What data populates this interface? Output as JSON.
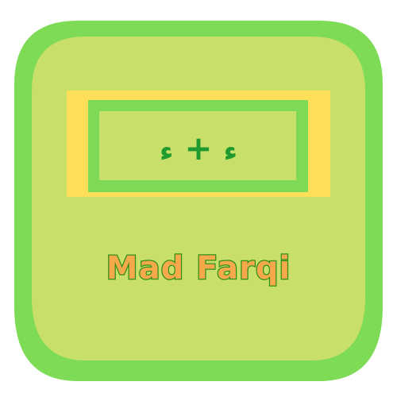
{
  "badge": {
    "formula": {
      "left_glyph": "ء",
      "operator": "+",
      "right_glyph": "ء"
    },
    "title": "Mad Farqi",
    "colors": {
      "outer_green": "#7ddb55",
      "inner_green": "#c8e06a",
      "yellow_frame": "#ffde59",
      "green_frame": "#7ed957",
      "text_green": "#1f9a2e",
      "title_fill": "#f7a84a",
      "title_stroke": "#2f8f19"
    }
  }
}
